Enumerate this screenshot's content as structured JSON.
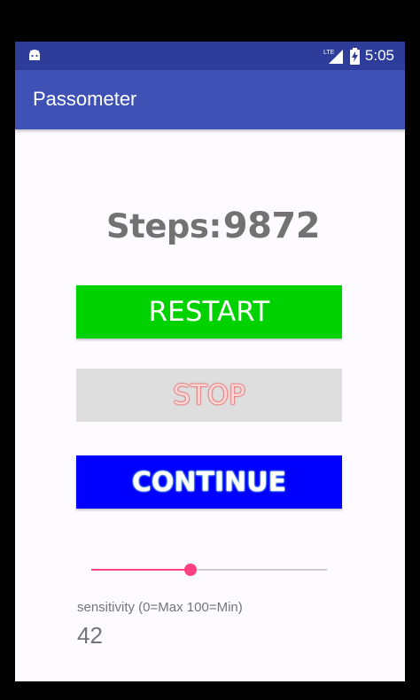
{
  "status_bar": {
    "time": "5:05",
    "network_label": "LTE",
    "left_icon": "android-debug-icon",
    "signal_icon": "signal-icon",
    "battery_icon": "battery-charging-icon"
  },
  "app_bar": {
    "title": "Passometer"
  },
  "steps": {
    "label": "Steps:",
    "value": "9872"
  },
  "buttons": {
    "restart": "RESTART",
    "stop": "STOP",
    "continue": "CONTINUE"
  },
  "sensitivity": {
    "label": "sensitivity (0=Max 100=Min)",
    "value": "42",
    "slider_level_percent": 42
  },
  "colors": {
    "status_bar": "#2e3d99",
    "app_bar": "#3f51b5",
    "restart_button": "#00d200",
    "stop_button": "#dedede",
    "continue_button": "#0000ff",
    "slider_accent": "#ff4081"
  }
}
